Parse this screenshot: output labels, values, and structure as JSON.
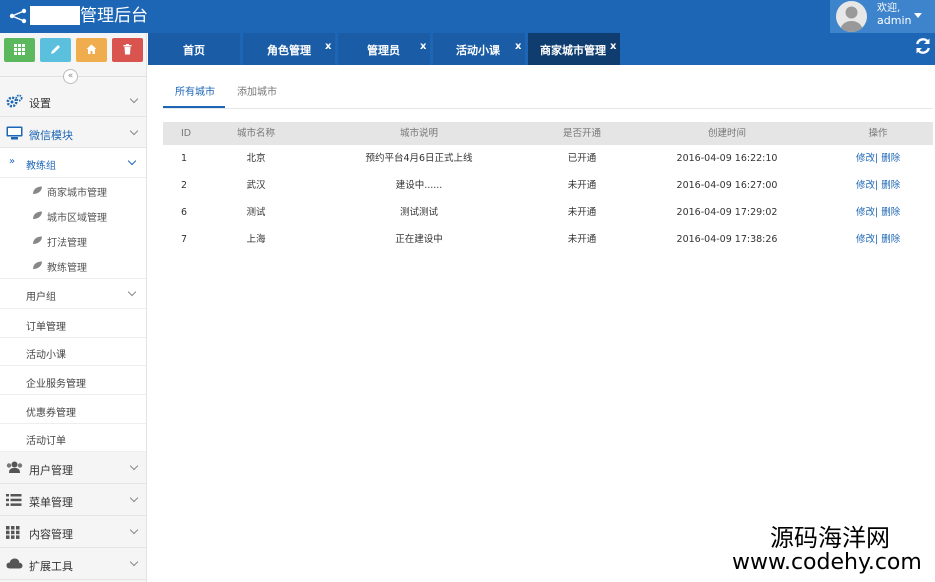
{
  "header": {
    "brand": "管理后台",
    "welcome": "欢迎,",
    "username": "admin"
  },
  "colors": {
    "primary": "#1d66b5",
    "active_tab": "#0f3d70",
    "green": "#5cb85c",
    "blue": "#5bc0de",
    "orange": "#f0ad4e",
    "red": "#d9534f"
  },
  "shortcuts": [
    "grid-icon",
    "pencil-icon",
    "home-icon",
    "trash-icon"
  ],
  "sidebar": {
    "collapse": "«",
    "settings": "设置",
    "wechat": "微信模块",
    "coach_group": "教练组",
    "coach_children": [
      "商家城市管理",
      "城市区域管理",
      "打法管理",
      "教练管理"
    ],
    "user_group": "用户组",
    "plain_items": [
      "订单管理",
      "活动小课",
      "企业服务管理",
      "优惠券管理",
      "活动订单"
    ],
    "user_mgmt": "用户管理",
    "menu_mgmt": "菜单管理",
    "content_mgmt": "内容管理",
    "tools": "扩展工具"
  },
  "tabs": [
    {
      "label": "首页",
      "close": ""
    },
    {
      "label": "角色管理",
      "close": "x"
    },
    {
      "label": "管理员",
      "close": "x"
    },
    {
      "label": "活动小课",
      "close": "x"
    },
    {
      "label": "商家城市管理",
      "close": "x"
    }
  ],
  "subtabs": {
    "all": "所有城市",
    "add": "添加城市"
  },
  "table": {
    "headers": [
      "ID",
      "城市名称",
      "城市说明",
      "是否开通",
      "创建时间",
      "操作"
    ],
    "rows": [
      {
        "id": "1",
        "name": "北京",
        "desc": "预约平台4月6日正式上线",
        "status": "已开通",
        "created": "2016-04-09 16:22:10"
      },
      {
        "id": "2",
        "name": "武汉",
        "desc": "建设中......",
        "status": "未开通",
        "created": "2016-04-09 16:27:00"
      },
      {
        "id": "6",
        "name": "测试",
        "desc": "测试测试",
        "status": "未开通",
        "created": "2016-04-09 17:29:02"
      },
      {
        "id": "7",
        "name": "上海",
        "desc": "正在建设中",
        "status": "未开通",
        "created": "2016-04-09 17:38:26"
      }
    ],
    "edit": "修改",
    "sep": "|",
    "delete": "删除"
  },
  "watermark": {
    "line1": "源码海洋网",
    "line2": "www.codehy.com"
  }
}
